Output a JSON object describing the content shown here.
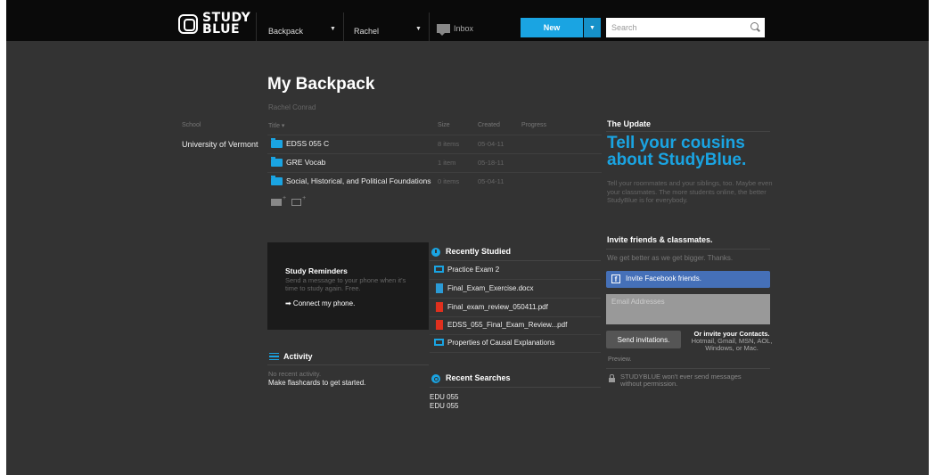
{
  "header": {
    "logo_line1": "STUDY",
    "logo_line2": "BLUE",
    "nav_backpack": "Backpack",
    "nav_user": "Rachel",
    "nav_inbox": "Inbox",
    "new_label": "New",
    "search_placeholder": "Search",
    "accent_color": "#1aa4e2"
  },
  "backpack": {
    "title": "My Backpack",
    "owner": "Rachel Conrad",
    "columns": {
      "school": "School",
      "title": "Title ▾",
      "size": "Size",
      "created": "Created",
      "progress": "Progress"
    },
    "school": "University of Vermont",
    "rows": [
      {
        "title": "EDSS 055 C",
        "size": "8 items",
        "created": "05-04-11"
      },
      {
        "title": "GRE Vocab",
        "size": "1 item",
        "created": "05-18-11"
      },
      {
        "title": "Social, Historical, and Political Foundations",
        "size": "0 items",
        "created": "05-04-11"
      }
    ]
  },
  "reminders": {
    "title": "Study Reminders",
    "text": "Send a message to your phone when it's time to study again. Free.",
    "link": "➡ Connect my phone."
  },
  "activity": {
    "title": "Activity",
    "none": "No recent activity.",
    "cta": "Make flashcards to get started."
  },
  "recently_studied": {
    "title": "Recently Studied",
    "items": [
      {
        "label": "Practice Exam 2",
        "icon": "deck-icon"
      },
      {
        "label": "Final_Exam_Exercise.docx",
        "icon": "doc-icon"
      },
      {
        "label": "Final_exam_review_050411.pdf",
        "icon": "pdf-icon"
      },
      {
        "label": "EDSS_055_Final_Exam_Review...pdf",
        "icon": "pdf-icon"
      },
      {
        "label": "Properties of Causal Explanations",
        "icon": "deck-icon"
      }
    ]
  },
  "recent_searches": {
    "title": "Recent Searches",
    "items": [
      "EDU 055",
      "EDU 055"
    ]
  },
  "update": {
    "title": "The Update",
    "headline": "Tell your cousins about StudyBlue.",
    "text": "Tell your roommates and your siblings, too. Maybe even your classmates. The more students online, the better StudyBlue is for everybody."
  },
  "invite": {
    "title": "Invite friends & classmates.",
    "subtitle": "We get better as we get bigger. Thanks.",
    "facebook_label": "Invite Facebook friends.",
    "email_placeholder": "Email Addresses",
    "send_label": "Send invitations.",
    "contacts_title": "Or invite your Contacts.",
    "contacts_text": "Hotmail, Gmail, MSN, AOL, Windows, or Mac.",
    "preview": "Preview.",
    "permission": "STUDYBLUE won't ever send messages without permission."
  }
}
